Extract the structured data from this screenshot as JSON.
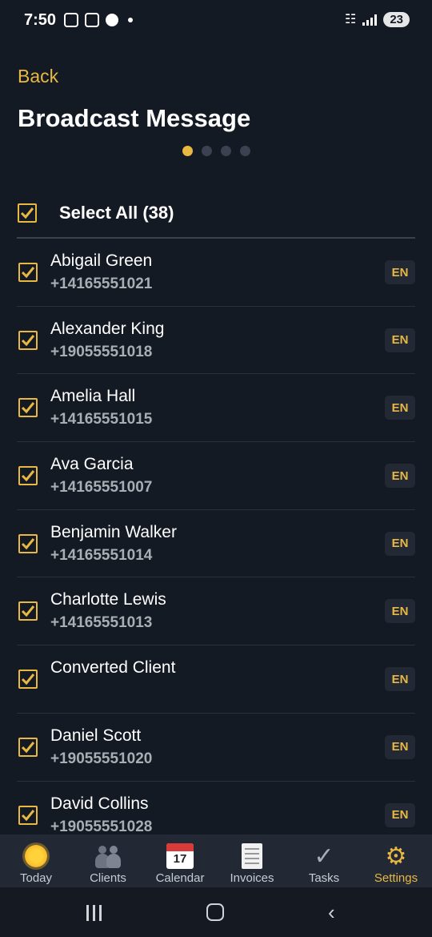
{
  "status_bar": {
    "time": "7:50",
    "battery": "23"
  },
  "header": {
    "back_label": "Back",
    "title": "Broadcast Message",
    "step_dots": 4,
    "active_step": 1
  },
  "select_all": {
    "label": "Select All (38)",
    "checked": true
  },
  "contacts": [
    {
      "name": "Abigail Green",
      "phone": "+14165551021",
      "lang": "EN",
      "checked": true
    },
    {
      "name": "Alexander King",
      "phone": "+19055551018",
      "lang": "EN",
      "checked": true
    },
    {
      "name": "Amelia Hall",
      "phone": "+14165551015",
      "lang": "EN",
      "checked": true
    },
    {
      "name": "Ava Garcia",
      "phone": "+14165551007",
      "lang": "EN",
      "checked": true
    },
    {
      "name": "Benjamin Walker",
      "phone": "+14165551014",
      "lang": "EN",
      "checked": true
    },
    {
      "name": "Charlotte Lewis",
      "phone": "+14165551013",
      "lang": "EN",
      "checked": true
    },
    {
      "name": "Converted Client",
      "phone": "",
      "lang": "EN",
      "checked": true
    },
    {
      "name": "Daniel Scott",
      "phone": "+19055551020",
      "lang": "EN",
      "checked": true
    },
    {
      "name": "David Collins",
      "phone": "+19055551028",
      "lang": "EN",
      "checked": true
    }
  ],
  "bottom_nav": {
    "items": [
      {
        "label": "Today",
        "icon": "sun-icon"
      },
      {
        "label": "Clients",
        "icon": "people-icon"
      },
      {
        "label": "Calendar",
        "icon": "calendar-icon",
        "calendar_day": "17"
      },
      {
        "label": "Invoices",
        "icon": "document-icon"
      },
      {
        "label": "Tasks",
        "icon": "checkmark-icon"
      },
      {
        "label": "Settings",
        "icon": "gear-icon"
      }
    ],
    "active": "Settings"
  },
  "colors": {
    "background": "#141a24",
    "accent": "#e8b843",
    "nav_background": "#222834",
    "secondary_text": "#a9adb4"
  }
}
